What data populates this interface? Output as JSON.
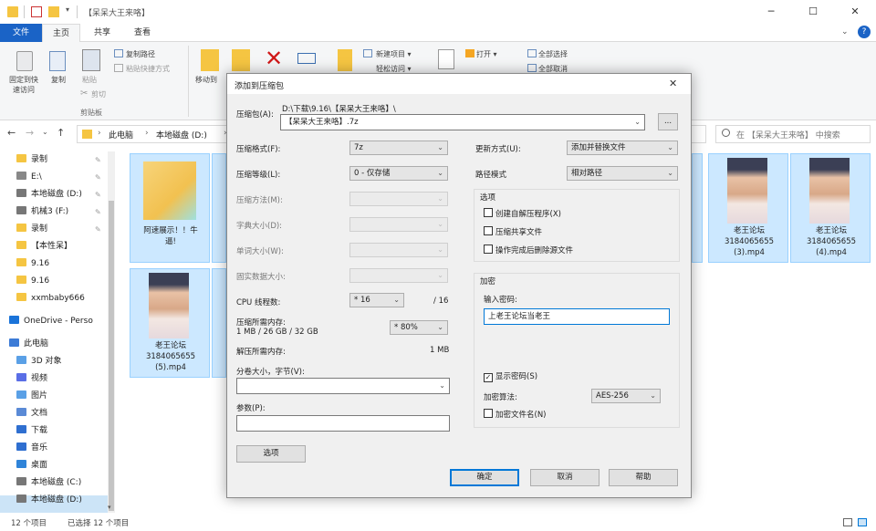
{
  "window": {
    "title": "【呆呆大王来咯】",
    "minimize": "─",
    "maximize": "☐",
    "close": "✕",
    "help": "?"
  },
  "ribbon": {
    "tabs": [
      "文件",
      "主页",
      "共享",
      "查看"
    ],
    "pin_label": "固定到快\n速访问",
    "copy_label": "复制",
    "paste_label": "粘贴",
    "copy_path": "复制路径",
    "paste_shortcut": "粘贴快捷方式",
    "cut": "剪切",
    "clipboard": "剪贴板",
    "move_to": "移动到",
    "new_item": "新建项目 ▾",
    "easy_access": "轻松访问 ▾",
    "open": "打开 ▾",
    "select_all": "全部选择",
    "select_none": "全部取消"
  },
  "address": {
    "path": [
      "此电脑",
      "本地磁盘 (D:)"
    ],
    "search_placeholder": "在 【呆呆大王来咯】 中搜索"
  },
  "nav": {
    "items": [
      {
        "label": "录制",
        "color": "#f5c542"
      },
      {
        "label": "E:\\",
        "color": "#888"
      },
      {
        "label": "本地磁盘 (D:)",
        "color": "#777"
      },
      {
        "label": "机械3 (F:)",
        "color": "#777"
      },
      {
        "label": "录制",
        "color": "#f5c542"
      },
      {
        "label": "【本性呆】",
        "color": "#f5c542"
      },
      {
        "label": "9.16",
        "color": "#f5c542"
      },
      {
        "label": "9.16",
        "color": "#f5c542"
      },
      {
        "label": "xxmbaby666",
        "color": "#f5c542"
      },
      {
        "label": "OneDrive - Perso",
        "color": "#1a73d9"
      },
      {
        "label": "此电脑",
        "color": "#3c7bd6"
      },
      {
        "label": "3D 对象",
        "color": "#5aa0e6"
      },
      {
        "label": "视频",
        "color": "#5a6ee6"
      },
      {
        "label": "图片",
        "color": "#5aa0e6"
      },
      {
        "label": "文档",
        "color": "#5a8ad6"
      },
      {
        "label": "下载",
        "color": "#2f6fd0"
      },
      {
        "label": "音乐",
        "color": "#2f6fd0"
      },
      {
        "label": "桌面",
        "color": "#2f84d9"
      },
      {
        "label": "本地磁盘 (C:)",
        "color": "#777"
      },
      {
        "label": "本地磁盘 (D:)",
        "color": "#777"
      }
    ]
  },
  "files": [
    {
      "name": "阿速展示！！牛\n逼!",
      "type": "folder"
    },
    {
      "name": "老王论坛\n3184065655\n(3).mp4",
      "type": "video"
    },
    {
      "name": "老王论坛\n3184065655\n(4).mp4",
      "type": "video"
    },
    {
      "name": "老王论坛\n3184065655\n(5).mp4",
      "type": "video"
    }
  ],
  "status": {
    "count": "12 个项目",
    "selected": "已选择 12 个项目"
  },
  "dialog": {
    "title": "添加到压缩包",
    "close": "✕",
    "archive_label": "压缩包(A):",
    "archive_dir": "D:\\下载\\9.16\\【呆呆大王来咯】\\",
    "archive_name": "【呆呆大王来咯】.7z",
    "browse": "...",
    "format_label": "压缩格式(F):",
    "format_value": "7z",
    "level_label": "压缩等级(L):",
    "level_value": "0 - 仅存储",
    "method_label": "压缩方法(M):",
    "dict_label": "字典大小(D):",
    "word_label": "单词大小(W):",
    "solid_label": "固实数据大小:",
    "threads_label": "CPU 线程数:",
    "threads_value": "* 16",
    "threads_max": "/ 16",
    "mem_label": "压缩所需内存:",
    "mem_value_label": "1 MB / 26 GB / 32 GB",
    "mem_percent": "* 80%",
    "decomp_label": "解压所需内存:",
    "decomp_value": "1 MB",
    "split_label": "分卷大小，字节(V):",
    "params_label": "参数(P):",
    "options_btn": "选项",
    "update_label": "更新方式(U):",
    "update_value": "添加并替换文件",
    "path_label": "路径模式",
    "path_value": "相对路径",
    "options_group": "选项",
    "opt_sfx": "创建自解压程序(X)",
    "opt_shared": "压缩共享文件",
    "opt_delete": "操作完成后删除源文件",
    "encrypt_group": "加密",
    "password_label": "输入密码:",
    "password_value": "上老王论坛当老王",
    "show_pw": "显示密码(S)",
    "enc_method_label": "加密算法:",
    "enc_method_value": "AES-256",
    "enc_names": "加密文件名(N)",
    "ok": "确定",
    "cancel": "取消",
    "help": "帮助"
  }
}
